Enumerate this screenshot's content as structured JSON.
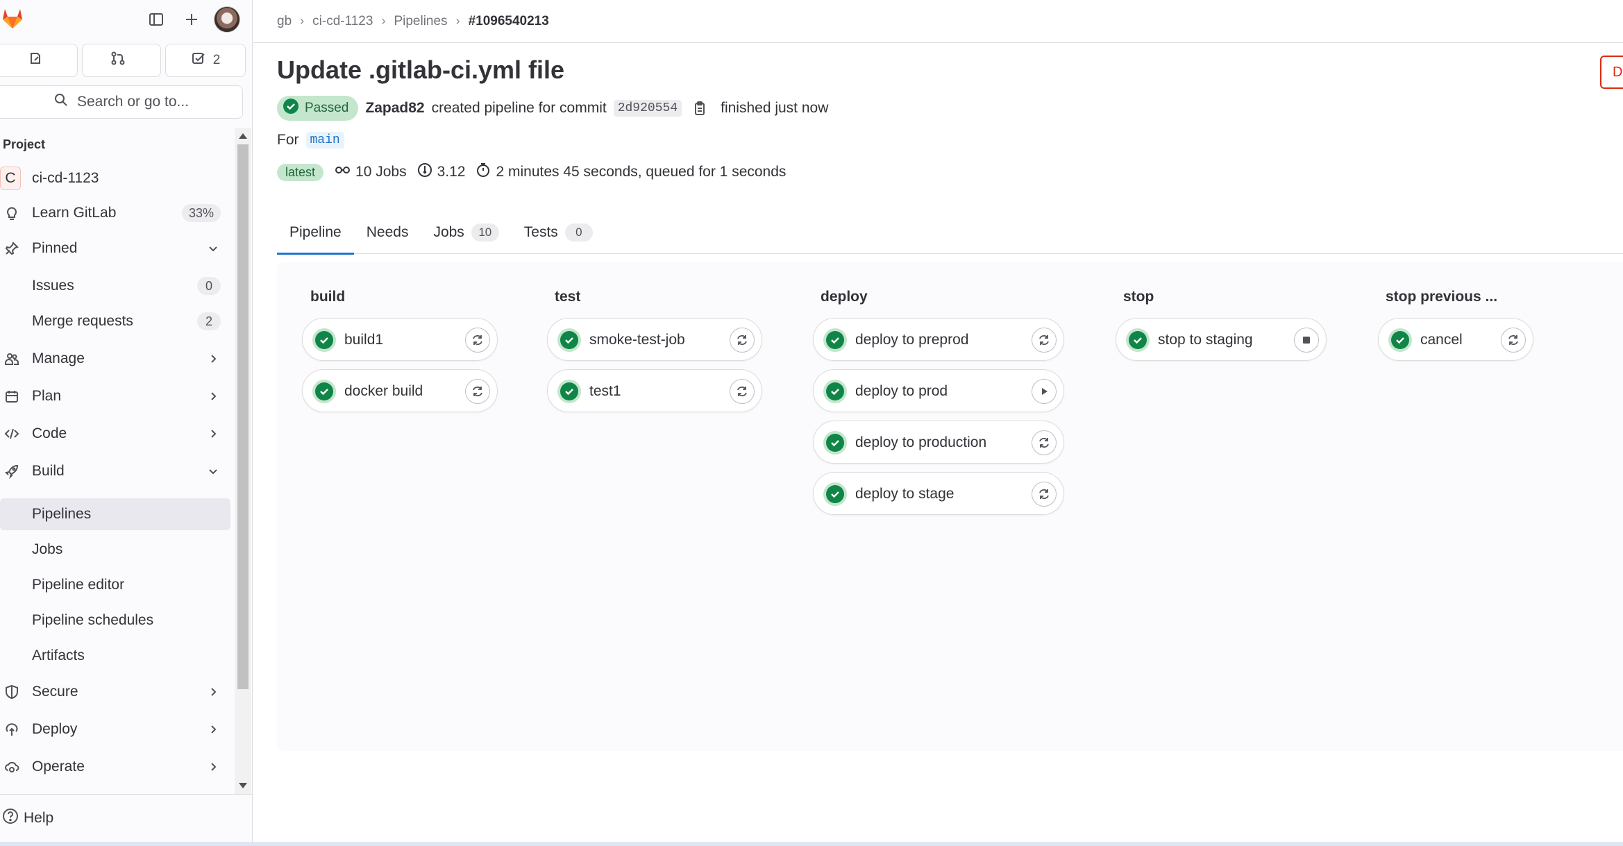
{
  "sidebar": {
    "cards": [
      {
        "icon": "issues-icon",
        "label": ""
      },
      {
        "icon": "merge-request-icon",
        "label": ""
      },
      {
        "icon": "todo-icon",
        "label": "2"
      }
    ],
    "search_label": "Search or go to...",
    "section_label": "Project",
    "project": {
      "initial": "C",
      "name": "ci-cd-1123"
    },
    "learn": {
      "label": "Learn GitLab",
      "percent": "33%"
    },
    "pinned": {
      "label": "Pinned",
      "items": [
        {
          "label": "Issues",
          "count": "0"
        },
        {
          "label": "Merge requests",
          "count": "2"
        }
      ]
    },
    "groups": [
      {
        "label": "Manage",
        "icon": "users-icon"
      },
      {
        "label": "Plan",
        "icon": "calendar-icon"
      },
      {
        "label": "Code",
        "icon": "code-icon"
      },
      {
        "label": "Build",
        "icon": "rocket-icon"
      }
    ],
    "build_items": [
      "Pipelines",
      "Jobs",
      "Pipeline editor",
      "Pipeline schedules",
      "Artifacts"
    ],
    "active_item": "Pipelines",
    "lower_groups": [
      {
        "label": "Secure",
        "icon": "shield-icon"
      },
      {
        "label": "Deploy",
        "icon": "deploy-icon"
      },
      {
        "label": "Operate",
        "icon": "cloud-gear-icon"
      }
    ],
    "help_label": "Help"
  },
  "breadcrumb": [
    "gb",
    "ci-cd-1123",
    "Pipelines",
    "#1096540213"
  ],
  "header": {
    "title": "Update .gitlab-ci.yml file",
    "right_button_label": "D",
    "status": "Passed",
    "author": "Zapad82",
    "action_text": "created pipeline for commit",
    "commit_sha": "2d920554",
    "finished_text": "finished just now",
    "for_label": "For",
    "branch": "main",
    "latest_badge": "latest",
    "jobs_text": "10 Jobs",
    "duration_value": "3.12",
    "timing_text": "2 minutes 45 seconds, queued for 1 seconds"
  },
  "tabs": [
    {
      "label": "Pipeline",
      "count": null,
      "active": true
    },
    {
      "label": "Needs",
      "count": null,
      "active": false
    },
    {
      "label": "Jobs",
      "count": "10",
      "active": false
    },
    {
      "label": "Tests",
      "count": "0",
      "active": false
    }
  ],
  "pipeline": {
    "stages": [
      {
        "name": "build",
        "jobs": [
          {
            "name": "build1",
            "status": "success",
            "action": "retry"
          },
          {
            "name": "docker build",
            "status": "success",
            "action": "retry"
          }
        ]
      },
      {
        "name": "test",
        "jobs": [
          {
            "name": "smoke-test-job",
            "status": "success",
            "action": "retry"
          },
          {
            "name": "test1",
            "status": "success",
            "action": "retry"
          }
        ]
      },
      {
        "name": "deploy",
        "jobs": [
          {
            "name": "deploy to preprod",
            "status": "success",
            "action": "retry"
          },
          {
            "name": "deploy to prod",
            "status": "success",
            "action": "play"
          },
          {
            "name": "deploy to production",
            "status": "success",
            "action": "retry"
          },
          {
            "name": "deploy to stage",
            "status": "success",
            "action": "retry"
          }
        ]
      },
      {
        "name": "stop",
        "jobs": [
          {
            "name": "stop to staging",
            "status": "success",
            "action": "stop"
          }
        ]
      },
      {
        "name": "stop previous ...",
        "jobs": [
          {
            "name": "cancel",
            "status": "success",
            "action": "retry"
          }
        ]
      }
    ]
  },
  "colors": {
    "success": "#108548",
    "success_bg": "#c3e6cd",
    "link_blue": "#1f75cb",
    "danger": "#dd2b0e"
  }
}
